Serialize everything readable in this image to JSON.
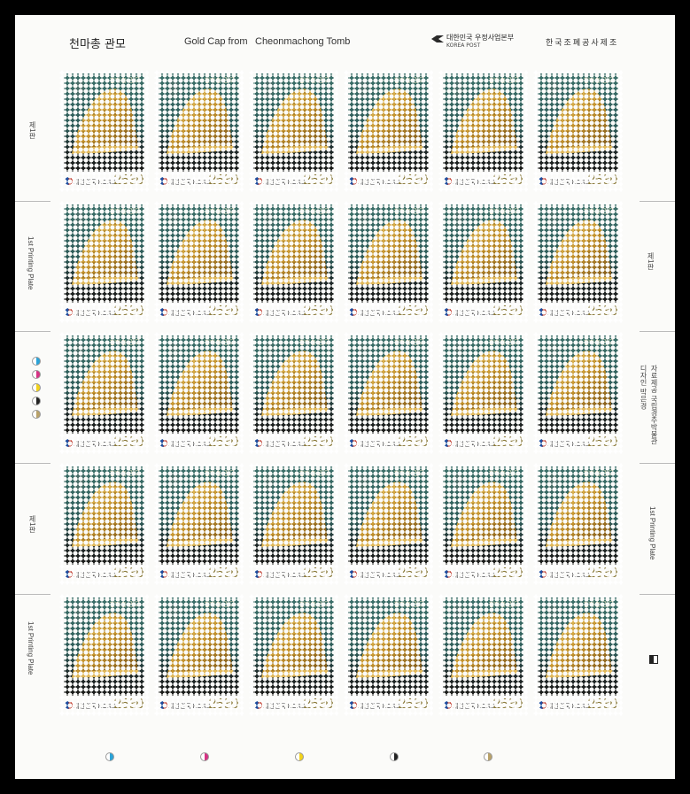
{
  "header": {
    "title_ko": "천마총 관모",
    "title_en_part1": "Gold Cap from",
    "title_en_part2": "Cheonmachong Tomb",
    "post_logo_top": "대한민국 우정사업본부",
    "post_logo_bottom": "KOREA POST",
    "maker": "한국조폐공사제조"
  },
  "margins": {
    "left_plate_ko": "제1판",
    "left_plate_en": "1st Printing Plate",
    "right_plate_ko": "제1판",
    "right_plate_en": "1st Printing Plate",
    "right_credit_1": "자료제공 국립경주박물관",
    "right_credit_2": "디자인 박은경"
  },
  "stamp": {
    "caption": "천마총 관모",
    "country": "대한민국 KOREA",
    "value": "2530"
  },
  "sheet": {
    "rows": 5,
    "columns": 6
  },
  "colors": {
    "cyan": "#2aa3d8",
    "magenta": "#d63384",
    "yellow": "#f2d21b",
    "black": "#222222",
    "gold": "#c8a24a"
  }
}
